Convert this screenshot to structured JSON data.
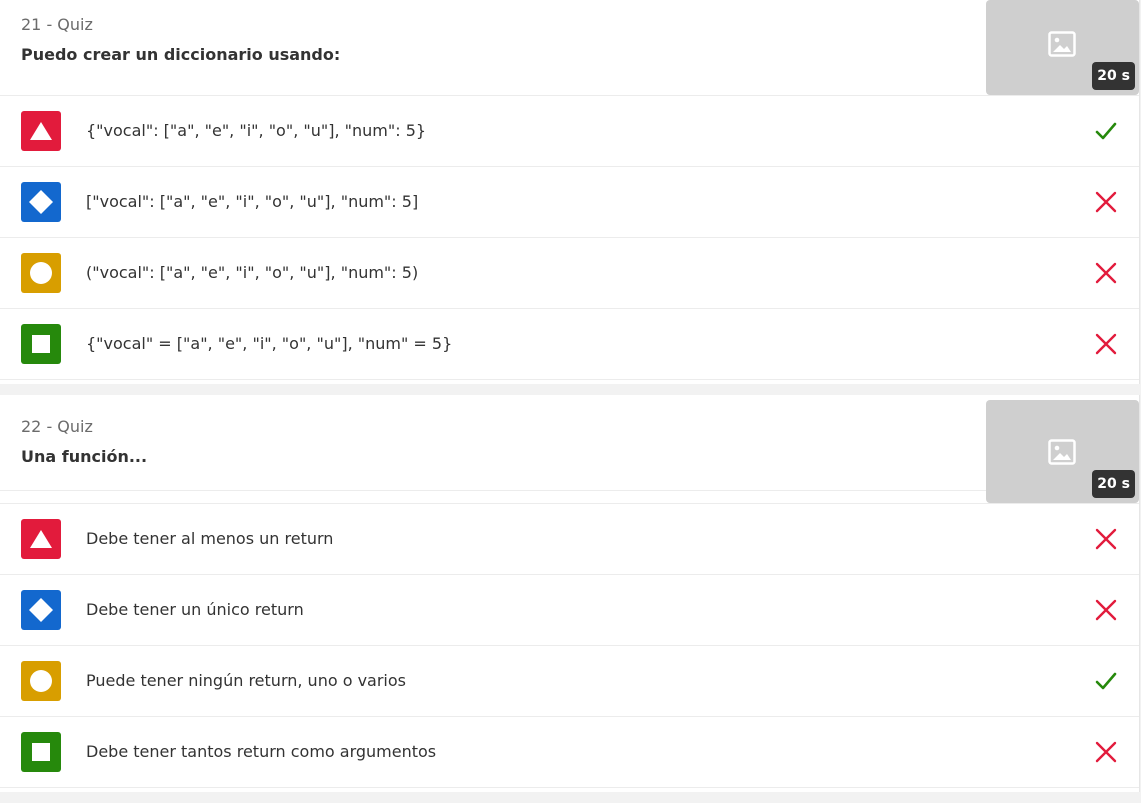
{
  "quizzes": [
    {
      "label": "21 - Quiz",
      "question": "Puedo crear un diccionario usando:",
      "time": "20 s",
      "answers": [
        {
          "shape": "triangle",
          "color": "#e21b3c",
          "text": "{\"vocal\": [\"a\", \"e\", \"i\", \"o\", \"u\"], \"num\": 5}",
          "correct": true
        },
        {
          "shape": "diamond",
          "color": "#1368ce",
          "text": "[\"vocal\": [\"a\", \"e\", \"i\", \"o\", \"u\"], \"num\": 5]",
          "correct": false
        },
        {
          "shape": "circle",
          "color": "#d89e00",
          "text": "(\"vocal\": [\"a\", \"e\", \"i\", \"o\", \"u\"], \"num\": 5)",
          "correct": false
        },
        {
          "shape": "square",
          "color": "#26890c",
          "text": "{\"vocal\" = [\"a\", \"e\", \"i\", \"o\", \"u\"], \"num\" = 5}",
          "correct": false
        }
      ]
    },
    {
      "label": "22 - Quiz",
      "question": "Una función...",
      "time": "20 s",
      "answers": [
        {
          "shape": "triangle",
          "color": "#e21b3c",
          "text": "Debe tener al menos un return",
          "correct": false
        },
        {
          "shape": "diamond",
          "color": "#1368ce",
          "text": "Debe tener un único return",
          "correct": false
        },
        {
          "shape": "circle",
          "color": "#d89e00",
          "text": "Puede tener ningún return, uno o varios",
          "correct": true
        },
        {
          "shape": "square",
          "color": "#26890c",
          "text": "Debe tener tantos return como argumentos",
          "correct": false
        }
      ]
    }
  ],
  "colors": {
    "correct": "#26890c",
    "incorrect": "#e21b3c"
  },
  "icons": {
    "thumbnail": "image-placeholder-icon",
    "correct": "checkmark-icon",
    "incorrect": "x-icon"
  }
}
